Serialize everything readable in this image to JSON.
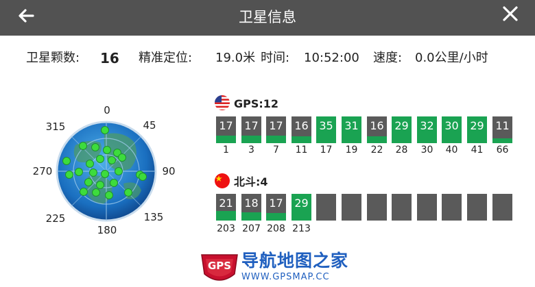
{
  "header": {
    "title": "卫星信息"
  },
  "info": {
    "sat_count_label": "卫星颗数:",
    "sat_count": "16",
    "accuracy_label": "精准定位:",
    "accuracy": "19.0米",
    "time_label": "时间:",
    "time": "10:52:00",
    "speed_label": "速度:",
    "speed": "0.0公里/小时"
  },
  "radar": {
    "labels": [
      "0",
      "45",
      "90",
      "135",
      "180",
      "225",
      "270",
      "315"
    ]
  },
  "gps": {
    "title": "GPS:12",
    "satellites": [
      {
        "prn": "1",
        "snr": 17,
        "level": 0.28
      },
      {
        "prn": "3",
        "snr": 17,
        "level": 0.28
      },
      {
        "prn": "7",
        "snr": 17,
        "level": 0.28
      },
      {
        "prn": "11",
        "snr": 16,
        "level": 0.26
      },
      {
        "prn": "17",
        "snr": 35,
        "level": 1.0
      },
      {
        "prn": "19",
        "snr": 31,
        "level": 1.0
      },
      {
        "prn": "22",
        "snr": 16,
        "level": 0.26
      },
      {
        "prn": "28",
        "snr": 29,
        "level": 1.0
      },
      {
        "prn": "30",
        "snr": 32,
        "level": 1.0
      },
      {
        "prn": "40",
        "snr": 30,
        "level": 1.0
      },
      {
        "prn": "41",
        "snr": 29,
        "level": 1.0
      },
      {
        "prn": "66",
        "snr": 11,
        "level": 0.18
      }
    ]
  },
  "beidou": {
    "title": "北斗:4",
    "satellites": [
      {
        "prn": "203",
        "snr": 21,
        "level": 0.35
      },
      {
        "prn": "207",
        "snr": 18,
        "level": 0.3
      },
      {
        "prn": "208",
        "snr": 17,
        "level": 0.28
      },
      {
        "prn": "213",
        "snr": 29,
        "level": 1.0
      },
      {
        "prn": "",
        "snr": "",
        "level": 0
      },
      {
        "prn": "",
        "snr": "",
        "level": 0
      },
      {
        "prn": "",
        "snr": "",
        "level": 0
      },
      {
        "prn": "",
        "snr": "",
        "level": 0
      },
      {
        "prn": "",
        "snr": "",
        "level": 0
      },
      {
        "prn": "",
        "snr": "",
        "level": 0
      },
      {
        "prn": "",
        "snr": "",
        "level": 0
      },
      {
        "prn": "",
        "snr": "",
        "level": 0
      }
    ]
  },
  "watermark": {
    "logo_text": "GPS",
    "name": "导航地图之家",
    "url": "WWW.GPSMAP.CC"
  },
  "colors": {
    "header_bg": "#525252",
    "bar_bg": "#5a5a5a",
    "bar_fill": "#1aa352",
    "dot": "#3ddc3d",
    "watermark": "#1f5fbf"
  },
  "icons": {
    "back": "arrow-left-icon",
    "close": "close-icon",
    "gps_flag": "usa-flag-icon",
    "beidou_flag": "china-flag-icon"
  }
}
